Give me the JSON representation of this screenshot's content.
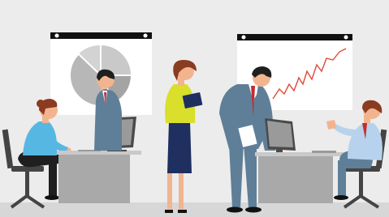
{
  "scene": {
    "kind": "flat-vector-illustration",
    "subject": "office-workers-at-desks",
    "colors": {
      "wall": "#ececec",
      "floor": "#d7d7d7",
      "board_frame": "#111111",
      "board_face": "#ffffff",
      "desk_top": "#c9c9c9",
      "desk_front": "#a9a9a9",
      "monitor_frame": "#4a4a4a",
      "monitor_screen": "#9a9a9a",
      "chair": "#444444",
      "skin": "#f2b48f",
      "hair_brown": "#8a3b20",
      "hair_dark": "#1f1f1f",
      "shirt_light_blue": "#56b7e3",
      "suit_slate": "#5f7f98",
      "blouse_yellow": "#d9df2a",
      "skirt_navy": "#1f2f5f",
      "tie_red": "#c42b2b",
      "chart_line": "#e04a3a",
      "pie_gray": "#b7b7b7"
    },
    "icons": [
      "pie-chart-icon",
      "line-chart-icon"
    ]
  }
}
